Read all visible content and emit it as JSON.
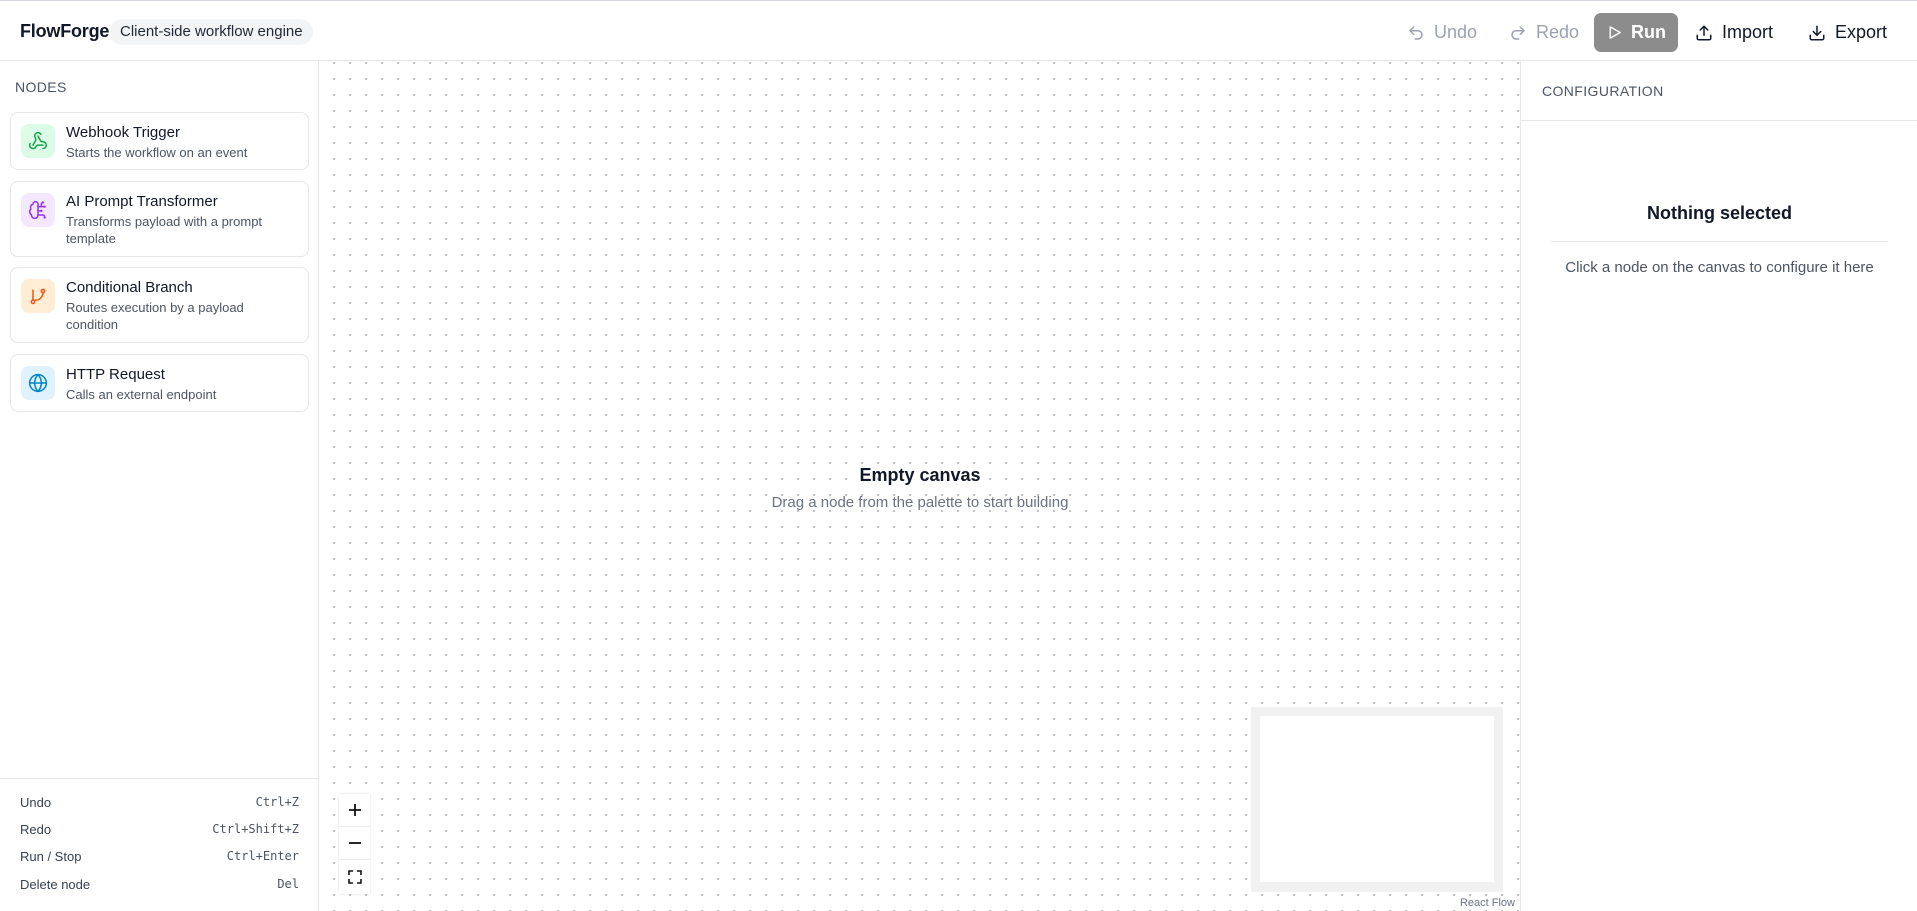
{
  "header": {
    "app_name": "FlowForge",
    "tagline": "Client-side workflow engine",
    "undo_label": "Undo",
    "redo_label": "Redo",
    "run_label": "Run",
    "import_label": "Import",
    "export_label": "Export"
  },
  "sidebar": {
    "title": "NODES",
    "nodes": [
      {
        "title": "Webhook Trigger",
        "description": "Starts the workflow on an event",
        "icon": "webhook-icon",
        "color": "#16a34a",
        "bg": "#dcfce7"
      },
      {
        "title": "AI Prompt Transformer",
        "description": "Transforms payload with a prompt template",
        "icon": "brain-circuit-icon",
        "color": "#9333ea",
        "bg": "#f3e8ff"
      },
      {
        "title": "Conditional Branch",
        "description": "Routes execution by a payload condition",
        "icon": "git-branch-icon",
        "color": "#ea580c",
        "bg": "#ffedd5"
      },
      {
        "title": "HTTP Request",
        "description": "Calls an external endpoint",
        "icon": "globe-icon",
        "color": "#0284c7",
        "bg": "#e0f2fe"
      }
    ]
  },
  "shortcuts": [
    {
      "label": "Undo",
      "key": "Ctrl+Z"
    },
    {
      "label": "Redo",
      "key": "Ctrl+Shift+Z"
    },
    {
      "label": "Run / Stop",
      "key": "Ctrl+Enter"
    },
    {
      "label": "Delete node",
      "key": "Del"
    }
  ],
  "canvas": {
    "empty_title": "Empty canvas",
    "empty_subtitle": "Drag a node from the palette to start building",
    "attribution": "React Flow"
  },
  "config": {
    "title": "CONFIGURATION",
    "empty_title": "Nothing selected",
    "empty_subtitle": "Click a node on the canvas to configure it here"
  }
}
